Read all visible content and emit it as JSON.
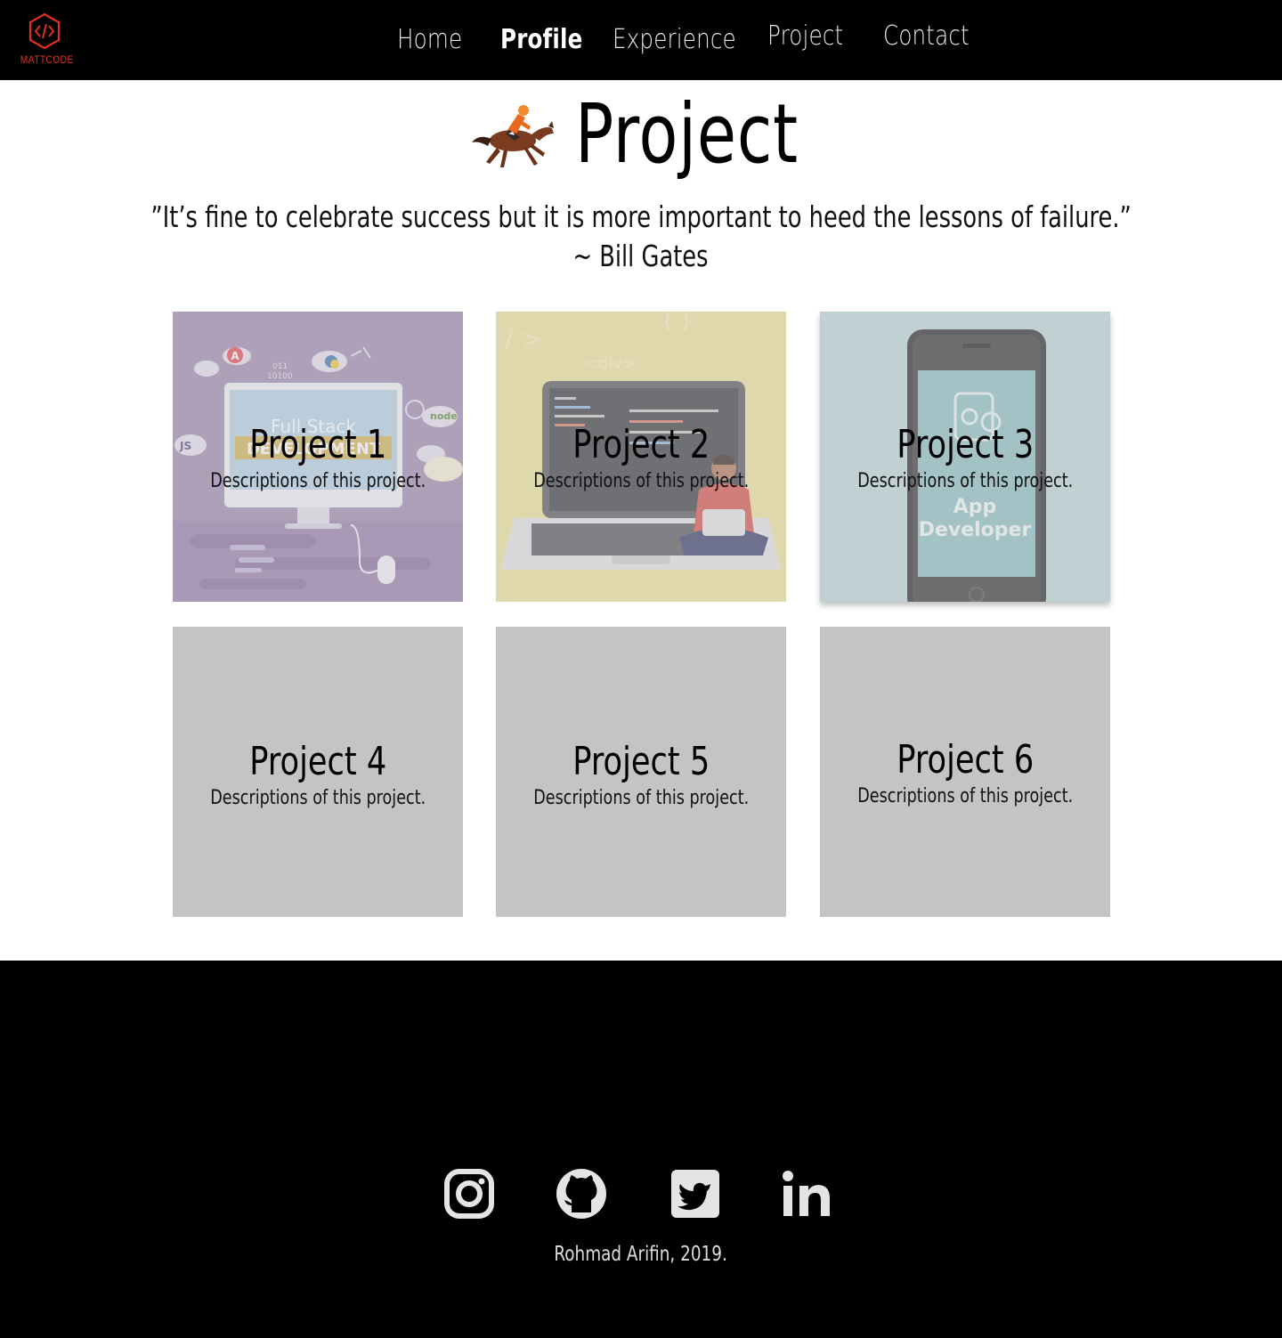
{
  "brand": {
    "name": "MATTCODE",
    "accent": "#e0301e",
    "logo_icon": "code-hexagon-icon"
  },
  "nav": {
    "home": "Home",
    "profile": "Profile",
    "experience": "Experience",
    "project": "Project",
    "contact": "Contact"
  },
  "page": {
    "title_emoji": "horse-racing-icon",
    "title": "Project",
    "quote_line1": "”It’s fine to celebrate success but it is more important to heed the lessons of failure.”",
    "quote_line2": "~ Bill Gates"
  },
  "projects": [
    {
      "title": "Project 1",
      "description": "Descriptions of this project.",
      "image": "full-stack-development-illustration",
      "image_text": "Full Stack DEVELOPMENT",
      "image_labels": [
        "011",
        "10100",
        "JS",
        "node"
      ]
    },
    {
      "title": "Project 2",
      "description": "Descriptions of this project.",
      "image": "laptop-developer-illustration",
      "image_labels": [
        "<div>",
        "{ }"
      ]
    },
    {
      "title": "Project 3",
      "description": "Descriptions of this project.",
      "image": "mobile-app-developer-illustration",
      "image_text": "App Developer"
    },
    {
      "title": "Project 4",
      "description": "Descriptions of this project."
    },
    {
      "title": "Project 5",
      "description": "Descriptions of this project."
    },
    {
      "title": "Project 6",
      "description": "Descriptions of this project."
    }
  ],
  "footer": {
    "social": [
      "instagram-icon",
      "github-icon",
      "twitter-icon",
      "linkedin-icon"
    ],
    "credit": "Rohmad Arifin, 2019."
  }
}
